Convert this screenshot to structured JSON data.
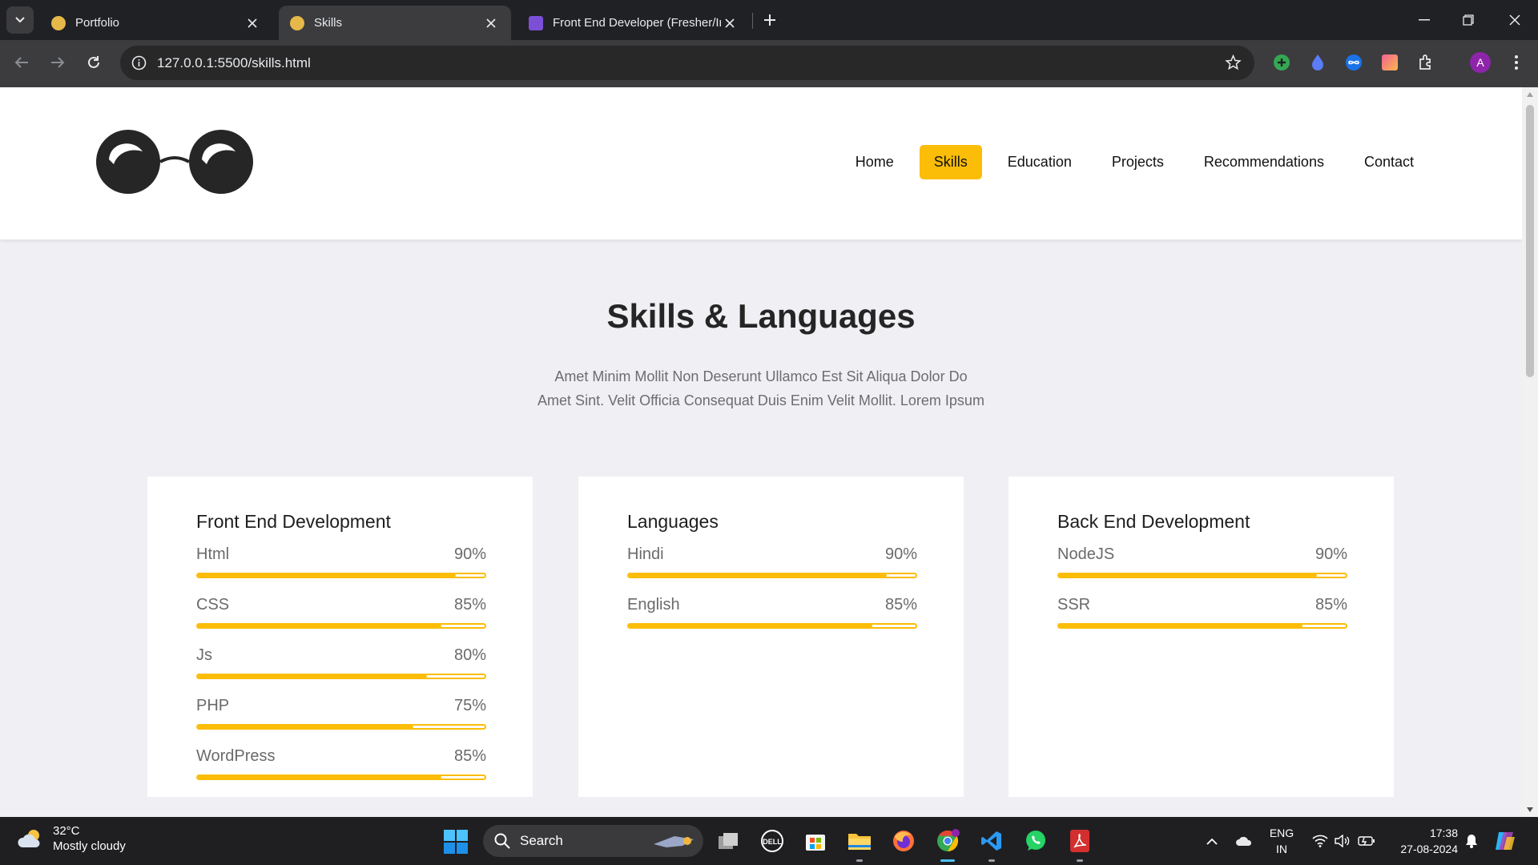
{
  "browser": {
    "tabs": [
      {
        "title": "Portfolio",
        "active": false
      },
      {
        "title": "Skills",
        "active": true
      },
      {
        "title": "Front End Developer (Fresher/Intern)",
        "active": false
      }
    ],
    "url": "127.0.0.1:5500/skills.html",
    "profile_initial": "A"
  },
  "site": {
    "nav": [
      "Home",
      "Skills",
      "Education",
      "Projects",
      "Recommendations",
      "Contact"
    ],
    "active_nav": "Skills",
    "accent_color": "#fbbd08",
    "section_title": "Skills & Languages",
    "section_subtitle": "Amet Minim Mollit Non Deserunt Ullamco Est Sit Aliqua Dolor Do Amet Sint. Velit Officia Consequat Duis Enim Velit Mollit. Lorem Ipsum"
  },
  "cards": [
    {
      "title": "Front End Development",
      "skills": [
        {
          "name": "Html",
          "percent_label": "90%",
          "level": 90
        },
        {
          "name": "CSS",
          "percent_label": "85%",
          "level": 85
        },
        {
          "name": "Js",
          "percent_label": "80%",
          "level": 80
        },
        {
          "name": "PHP",
          "percent_label": "75%",
          "level": 75
        },
        {
          "name": "WordPress",
          "percent_label": "85%",
          "level": 85
        }
      ]
    },
    {
      "title": "Languages",
      "skills": [
        {
          "name": "Hindi",
          "percent_label": "90%",
          "level": 90
        },
        {
          "name": "English",
          "percent_label": "85%",
          "level": 85
        }
      ]
    },
    {
      "title": "Back End Development",
      "skills": [
        {
          "name": "NodeJS",
          "percent_label": "90%",
          "level": 90
        },
        {
          "name": "SSR",
          "percent_label": "85%",
          "level": 85
        }
      ]
    }
  ],
  "taskbar": {
    "weather_temp": "32°C",
    "weather_desc": "Mostly cloudy",
    "search_label": "Search",
    "lang_line1": "ENG",
    "lang_line2": "IN",
    "time": "17:38",
    "date": "27-08-2024"
  }
}
